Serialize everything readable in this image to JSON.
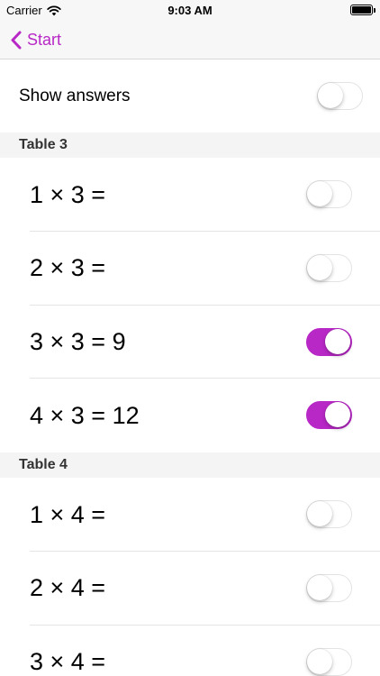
{
  "status_bar": {
    "carrier": "Carrier",
    "time": "9:03 AM"
  },
  "nav": {
    "back_label": "Start",
    "accent_color": "#b828c6"
  },
  "show_answers": {
    "label": "Show answers",
    "on": false
  },
  "sections": [
    {
      "header": "Table 3",
      "rows": [
        {
          "text": "1 × 3 =",
          "on": false
        },
        {
          "text": "2 × 3 =",
          "on": false
        },
        {
          "text": "3 × 3 = 9",
          "on": true
        },
        {
          "text": "4 × 3 = 12",
          "on": true
        }
      ]
    },
    {
      "header": "Table 4",
      "rows": [
        {
          "text": "1 × 4 =",
          "on": false
        },
        {
          "text": "2 × 4 =",
          "on": false
        },
        {
          "text": "3 × 4 =",
          "on": false
        }
      ]
    }
  ]
}
